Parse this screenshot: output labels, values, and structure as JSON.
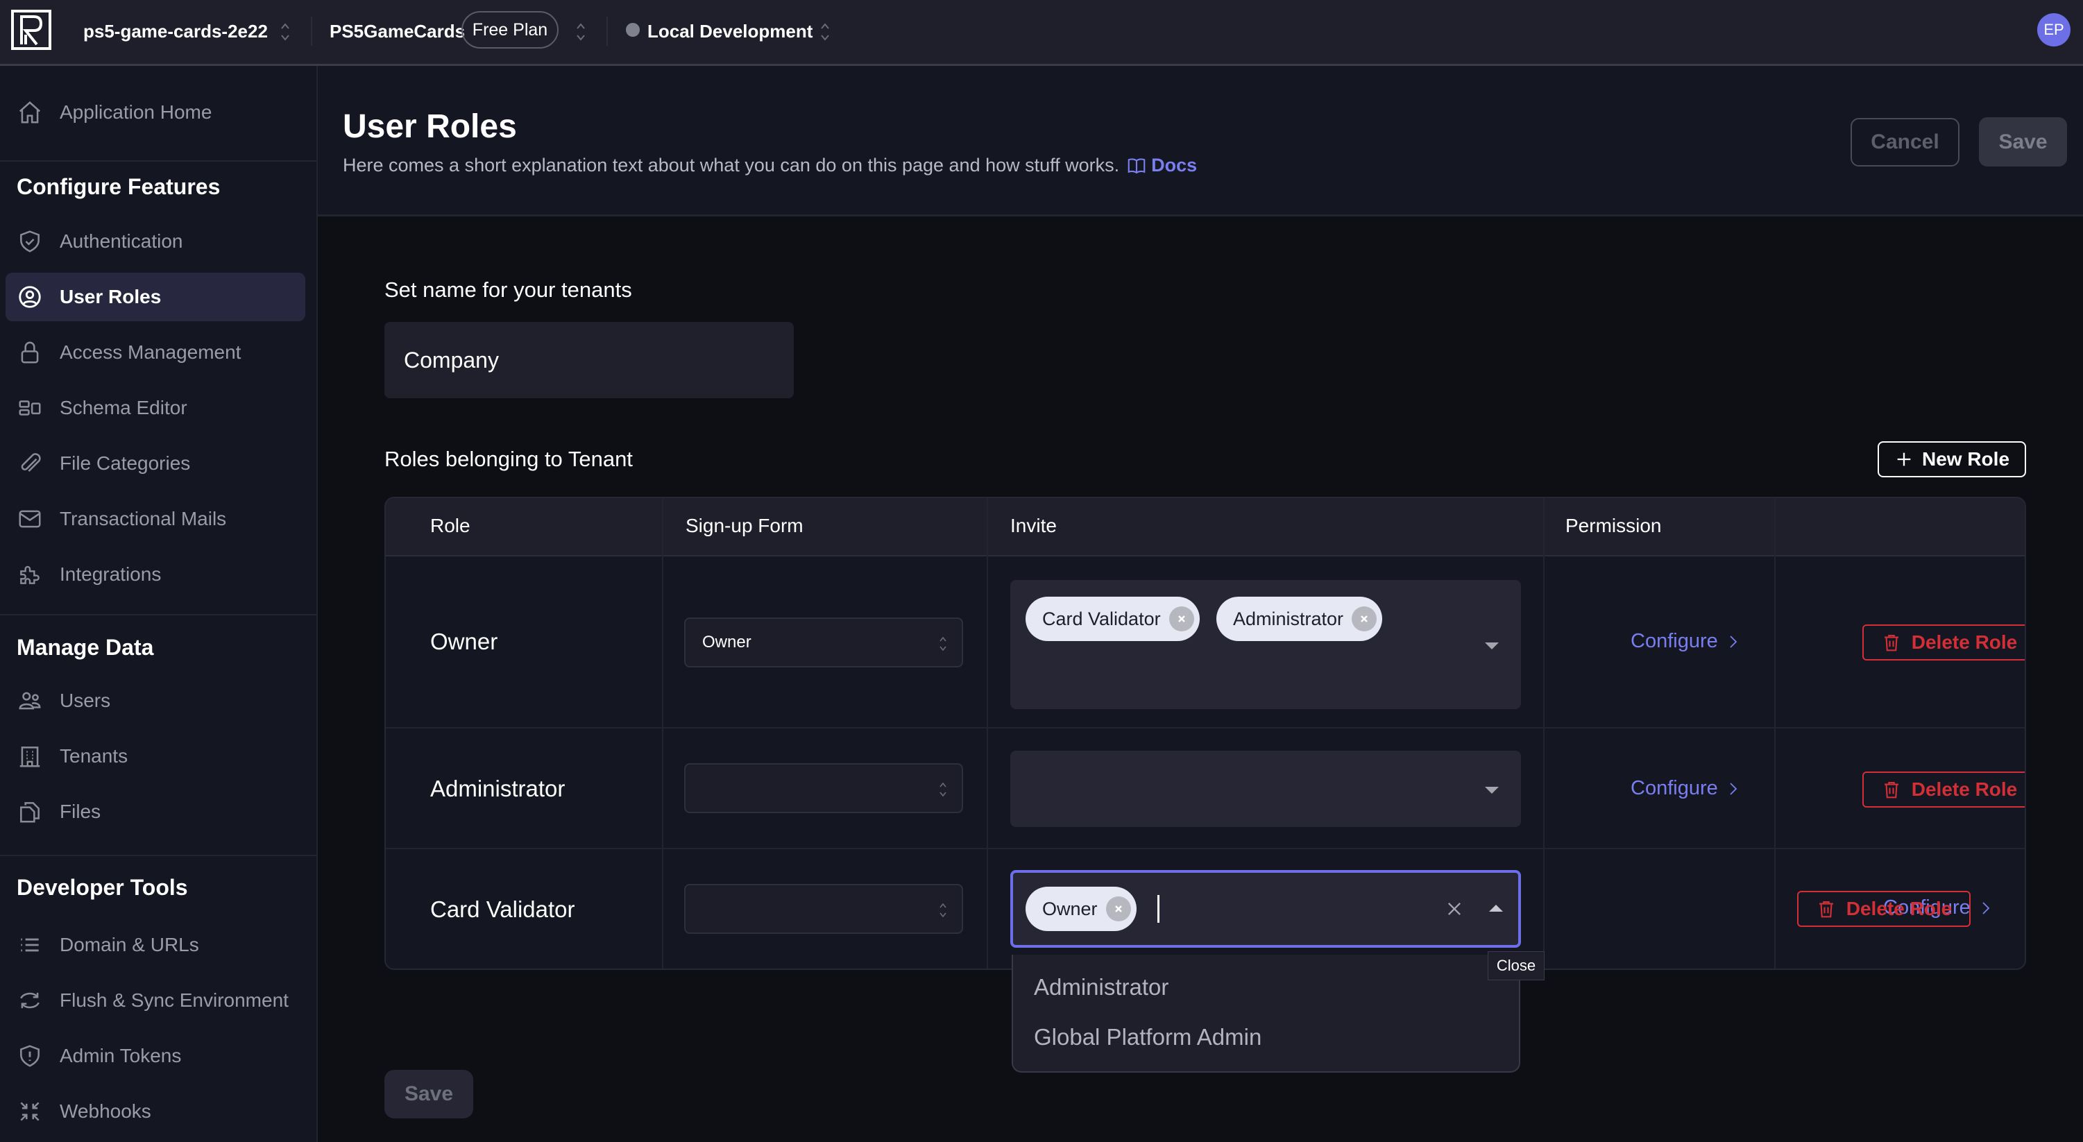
{
  "topbar": {
    "project": "ps5-game-cards-2e22",
    "app": "PS5GameCards",
    "plan": "Free Plan",
    "environment": "Local Development",
    "avatar_initials": "EP"
  },
  "sidebar": {
    "home": "Application Home",
    "sections": [
      {
        "heading": "Configure Features",
        "items": [
          {
            "label": "Authentication",
            "icon": "shield-check-icon"
          },
          {
            "label": "User Roles",
            "icon": "user-circle-icon",
            "active": true
          },
          {
            "label": "Access Management",
            "icon": "lock-icon"
          },
          {
            "label": "Schema Editor",
            "icon": "schema-icon"
          },
          {
            "label": "File Categories",
            "icon": "paperclip-icon"
          },
          {
            "label": "Transactional Mails",
            "icon": "envelope-icon"
          },
          {
            "label": "Integrations",
            "icon": "puzzle-icon"
          }
        ]
      },
      {
        "heading": "Manage Data",
        "items": [
          {
            "label": "Users",
            "icon": "users-icon"
          },
          {
            "label": "Tenants",
            "icon": "building-icon"
          },
          {
            "label": "Files",
            "icon": "files-icon"
          }
        ]
      },
      {
        "heading": "Developer Tools",
        "items": [
          {
            "label": "Domain & URLs",
            "icon": "list-icon"
          },
          {
            "label": "Flush & Sync Environment",
            "icon": "sync-icon"
          },
          {
            "label": "Admin Tokens",
            "icon": "shield-alert-icon"
          },
          {
            "label": "Webhooks",
            "icon": "arrows-in-icon"
          }
        ]
      }
    ]
  },
  "page": {
    "title": "User Roles",
    "subtitle": "Here comes a short explanation text about what you can do on this page and how stuff works.",
    "docs_label": "Docs",
    "cancel_label": "Cancel",
    "save_label": "Save"
  },
  "tenant": {
    "label": "Set name for your tenants",
    "value": "Company"
  },
  "roles": {
    "heading": "Roles belonging to Tenant",
    "new_role_label": "New Role",
    "columns": [
      "Role",
      "Sign-up Form",
      "Invite",
      "Permission",
      ""
    ],
    "rows": [
      {
        "name": "Owner",
        "signup": "Owner",
        "invite": [
          "Card Validator",
          "Administrator"
        ],
        "configure": "Configure",
        "delete": "Delete Role"
      },
      {
        "name": "Administrator",
        "signup": "",
        "invite": [],
        "configure": "Configure",
        "delete": "Delete Role"
      },
      {
        "name": "Card Validator",
        "signup": "",
        "invite": [
          "Owner"
        ],
        "configure": "Configure",
        "delete": "Delete Role"
      }
    ]
  },
  "invite_dropdown": {
    "options": [
      "Administrator",
      "Global Platform Admin"
    ],
    "tooltip": "Close"
  },
  "footer": {
    "save_label": "Save"
  },
  "colors": {
    "accent": "#6c6fe6",
    "danger": "#d22f37",
    "link": "#7a7ff0"
  }
}
